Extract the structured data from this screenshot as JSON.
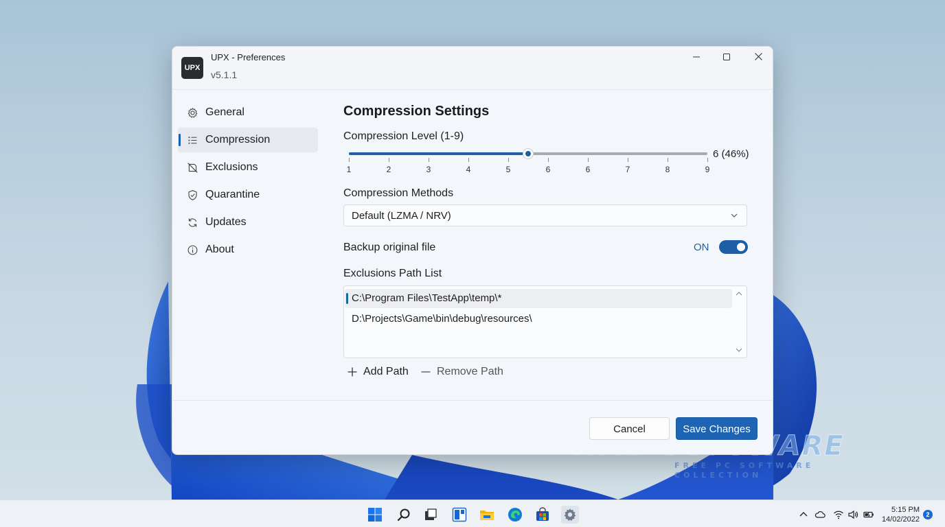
{
  "window": {
    "logo_text": "UPX",
    "title": "UPX - Preferences",
    "version": "v5.1.1",
    "controls": {
      "minimize_icon": "minimize-icon",
      "maximize_icon": "maximize-icon",
      "close_icon": "close-icon"
    }
  },
  "sidebar": {
    "items": [
      {
        "label": "General",
        "icon": "gear-icon",
        "active": false
      },
      {
        "label": "Compression",
        "icon": "list-icon",
        "active": true
      },
      {
        "label": "Exclusions",
        "icon": "exclusion-icon",
        "active": false
      },
      {
        "label": "Quarantine",
        "icon": "shield-icon",
        "active": false
      },
      {
        "label": "Updates",
        "icon": "refresh-icon",
        "active": false
      },
      {
        "label": "About",
        "icon": "info-icon",
        "active": false
      }
    ]
  },
  "main": {
    "title": "Compression Settings",
    "compression_level": {
      "label": "Compression Level (1-9)",
      "value_text": "6 (46%)",
      "fill_fraction": 0.5,
      "ticks": [
        "1",
        "2",
        "3",
        "4",
        "5",
        "6",
        "6",
        "7",
        "8",
        "9"
      ]
    },
    "methods": {
      "label": "Compression Methods",
      "selected": "Default (LZMA / NRV)"
    },
    "backup": {
      "label": "Backup original file",
      "state_text": "ON",
      "enabled": true
    },
    "exclusions": {
      "label": "Exclusions Path List",
      "paths": [
        "C:\\Program Files\\TestApp\\temp\\*",
        "D:\\Projects\\Game\\bin\\debug\\resources\\"
      ],
      "add_label": "Add Path",
      "remove_label": "Remove Path"
    }
  },
  "footer": {
    "cancel_label": "Cancel",
    "save_label": "Save Changes"
  },
  "watermark": {
    "main": "HMD SOFTWARE",
    "sub": "FREE PC SOFTWARE COLLECTION"
  },
  "taskbar": {
    "apps": [
      "windows-start-icon",
      "search-icon",
      "task-view-icon",
      "widgets-icon",
      "file-explorer-icon",
      "edge-icon",
      "store-icon",
      "settings-icon"
    ],
    "tray": [
      "chevron-up-icon",
      "cloud-icon",
      "wifi-icon",
      "volume-icon",
      "battery-icon"
    ],
    "time": "5:15 PM",
    "date": "14/02/2022",
    "notification_count": "2"
  },
  "colors": {
    "accent": "#1c5fa6",
    "save_button": "#1e64b4",
    "window_bg": "#f3f6fa"
  }
}
